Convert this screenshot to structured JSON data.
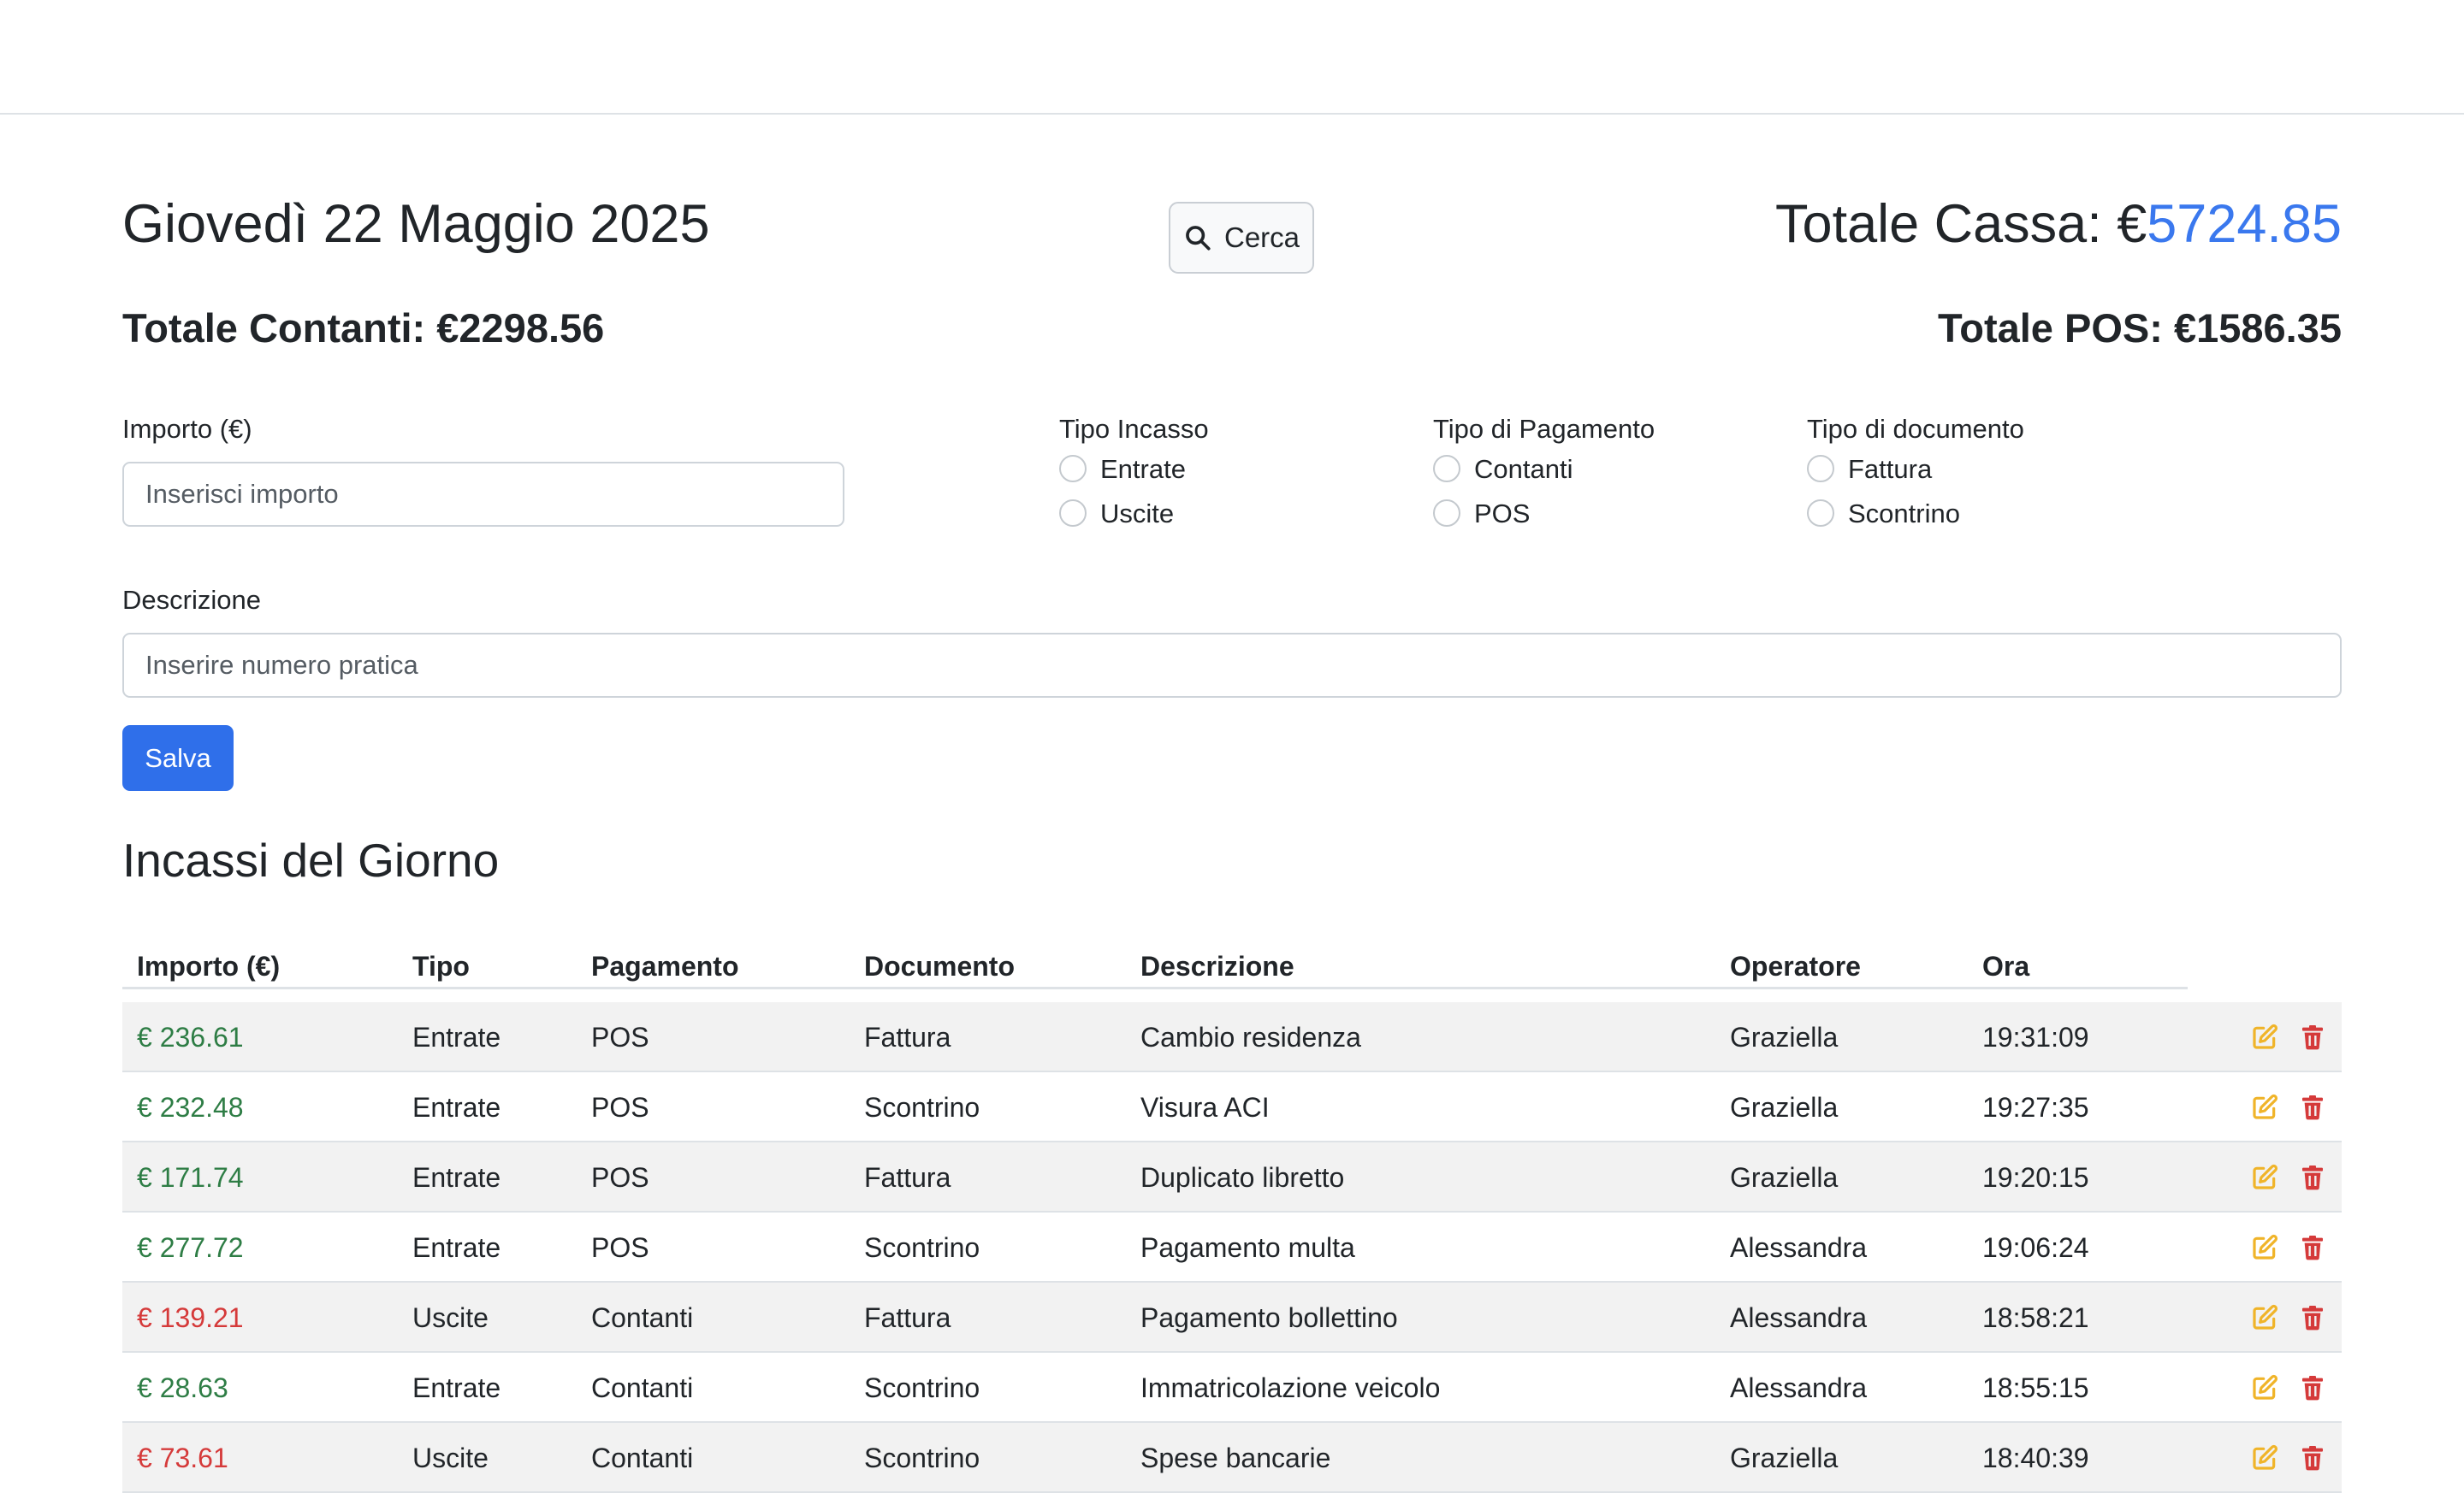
{
  "header": {
    "date": "Giovedì 22 Maggio 2025",
    "search_label": "Cerca",
    "totale_cassa_label": "Totale Cassa: €",
    "totale_cassa_value": "5724.85",
    "totale_contanti": "Totale Contanti: €2298.56",
    "totale_pos": "Totale POS: €1586.35"
  },
  "form": {
    "importo_label": "Importo (€)",
    "importo_placeholder": "Inserisci importo",
    "tipo_incasso_label": "Tipo Incasso",
    "tipo_incasso_options": [
      "Entrate",
      "Uscite"
    ],
    "tipo_pagamento_label": "Tipo di Pagamento",
    "tipo_pagamento_options": [
      "Contanti",
      "POS"
    ],
    "tipo_documento_label": "Tipo di documento",
    "tipo_documento_options": [
      "Fattura",
      "Scontrino"
    ],
    "descrizione_label": "Descrizione",
    "descrizione_placeholder": "Inserire numero pratica",
    "save_label": "Salva"
  },
  "table": {
    "title": "Incassi del Giorno",
    "columns": [
      "Importo (€)",
      "Tipo",
      "Pagamento",
      "Documento",
      "Descrizione",
      "Operatore",
      "Ora"
    ],
    "rows": [
      {
        "importo": "€ 236.61",
        "tipo": "Entrate",
        "pagamento": "POS",
        "documento": "Fattura",
        "descrizione": "Cambio residenza",
        "operatore": "Graziella",
        "ora": "19:31:09"
      },
      {
        "importo": "€ 232.48",
        "tipo": "Entrate",
        "pagamento": "POS",
        "documento": "Scontrino",
        "descrizione": "Visura ACI",
        "operatore": "Graziella",
        "ora": "19:27:35"
      },
      {
        "importo": "€ 171.74",
        "tipo": "Entrate",
        "pagamento": "POS",
        "documento": "Fattura",
        "descrizione": "Duplicato libretto",
        "operatore": "Graziella",
        "ora": "19:20:15"
      },
      {
        "importo": "€ 277.72",
        "tipo": "Entrate",
        "pagamento": "POS",
        "documento": "Scontrino",
        "descrizione": "Pagamento multa",
        "operatore": "Alessandra",
        "ora": "19:06:24"
      },
      {
        "importo": "€ 139.21",
        "tipo": "Uscite",
        "pagamento": "Contanti",
        "documento": "Fattura",
        "descrizione": "Pagamento bollettino",
        "operatore": "Alessandra",
        "ora": "18:58:21"
      },
      {
        "importo": "€ 28.63",
        "tipo": "Entrate",
        "pagamento": "Contanti",
        "documento": "Scontrino",
        "descrizione": "Immatricolazione veicolo",
        "operatore": "Alessandra",
        "ora": "18:55:15"
      },
      {
        "importo": "€ 73.61",
        "tipo": "Uscite",
        "pagamento": "Contanti",
        "documento": "Scontrino",
        "descrizione": "Spese bancarie",
        "operatore": "Graziella",
        "ora": "18:40:39"
      }
    ]
  },
  "colors": {
    "accent": "#2f6fea",
    "cassa_value": "#3a78ee",
    "entrate": "#2e7d45",
    "uscite": "#d53a3a",
    "edit_icon": "#f0b429",
    "delete_icon": "#d53a3a"
  },
  "icons": {
    "search": "search-icon",
    "edit": "edit-icon",
    "delete": "trash-icon"
  }
}
